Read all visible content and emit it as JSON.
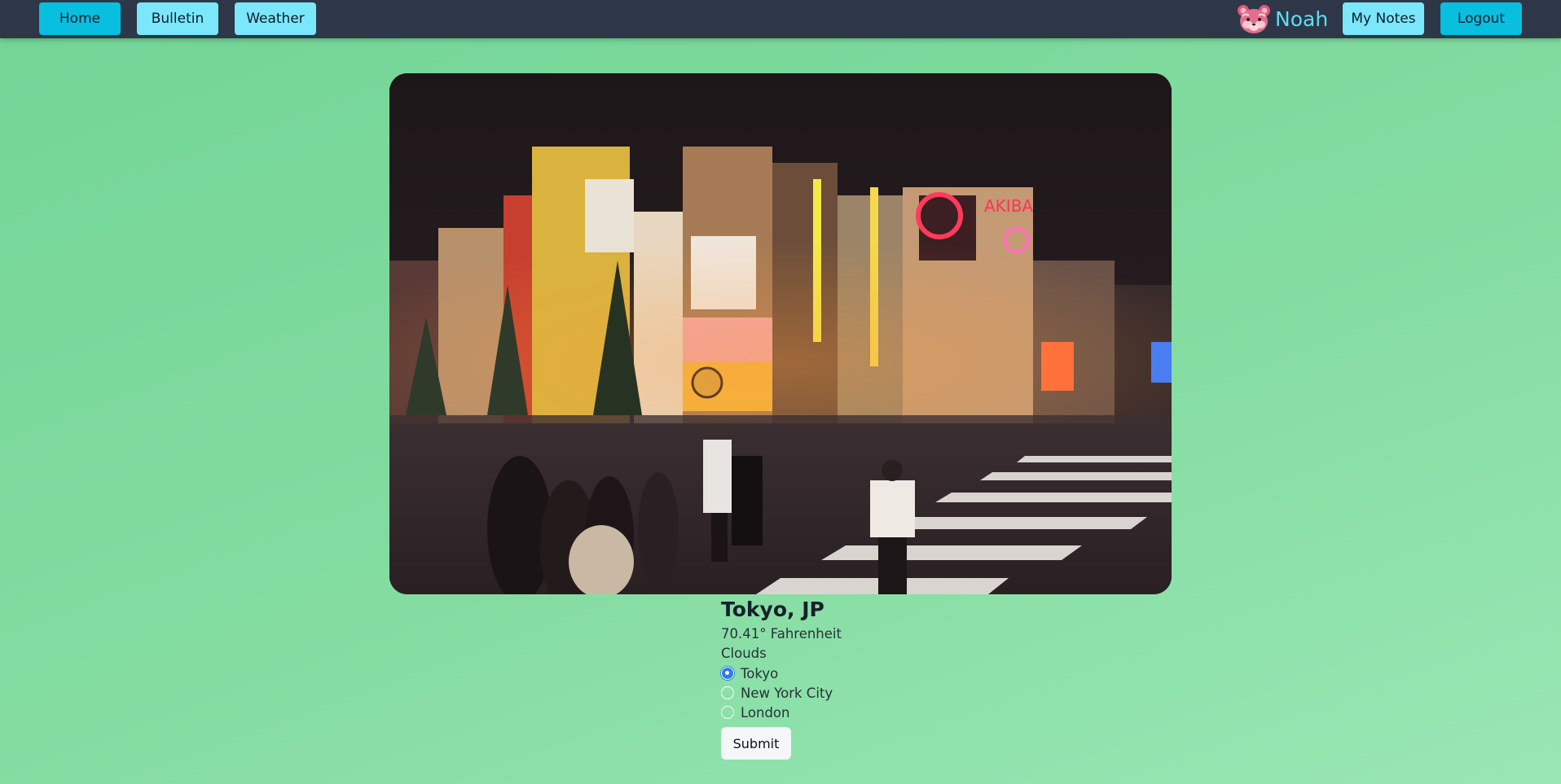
{
  "nav": {
    "home_label": "Home",
    "bulletin_label": "Bulletin",
    "weather_label": "Weather",
    "notes_label": "My Notes",
    "logout_label": "Logout",
    "user_name": "Noah",
    "avatar_icon": "red-panda-icon"
  },
  "weather": {
    "city": "Tokyo, JP",
    "temperature": "70.41° Fahrenheit",
    "condition": "Clouds",
    "options": [
      {
        "label": "Tokyo",
        "checked": true
      },
      {
        "label": "New York City",
        "checked": false
      },
      {
        "label": "London",
        "checked": false
      }
    ],
    "submit_label": "Submit",
    "image": "night-city-street-crossing-image"
  },
  "colors": {
    "navbar": "#2d3748",
    "button_dark": "#08bfe0",
    "button_light": "#7ae7fb",
    "username": "#5fdcf2",
    "background": "#7fd9a0",
    "radio_checked": "#2f7be6"
  }
}
